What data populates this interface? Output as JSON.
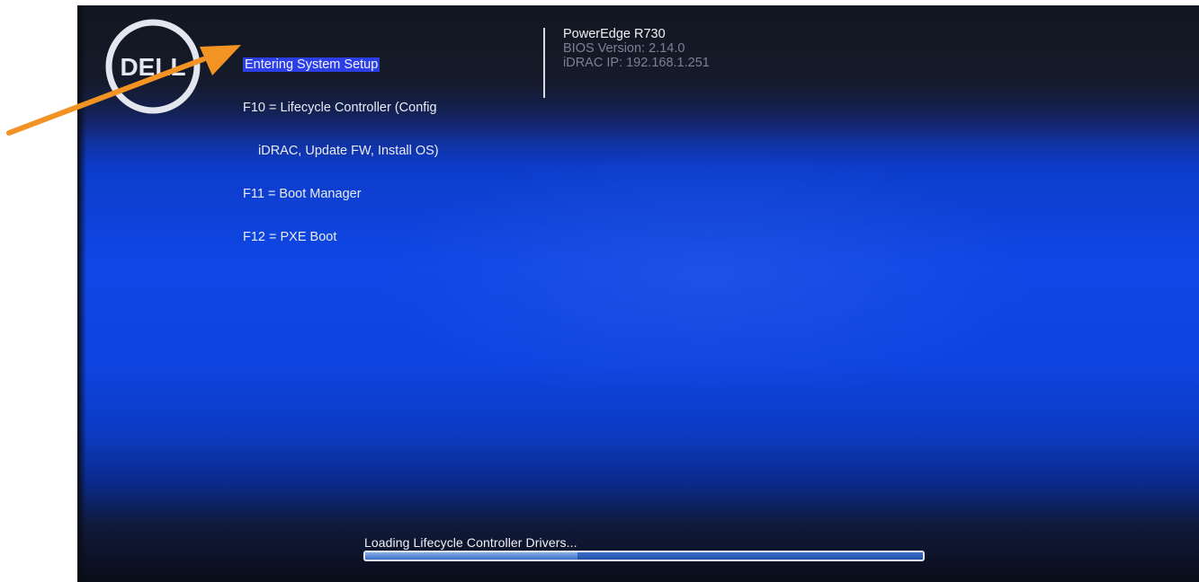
{
  "boot_menu": {
    "highlighted_option": "Entering System Setup",
    "f10_line1": "F10 = Lifecycle Controller (Config",
    "f10_line2": "iDRAC, Update FW, Install OS)",
    "f11": "F11 = Boot Manager",
    "f12": "F12 = PXE Boot"
  },
  "system_info": {
    "model": "PowerEdge R730",
    "bios_version": "BIOS Version: 2.14.0",
    "idrac_ip": "iDRAC IP:  192.168.1.251"
  },
  "logo": {
    "text": "DELL",
    "icon": "dell-logo-icon"
  },
  "progress": {
    "label": "Loading Lifecycle Controller Drivers...",
    "fraction": 0.38
  },
  "annotation": {
    "icon": "arrow-pointer-icon",
    "color": "#f39324"
  },
  "colors": {
    "highlight": "#2b3ee8",
    "screen_blue": "#0f47e6"
  }
}
